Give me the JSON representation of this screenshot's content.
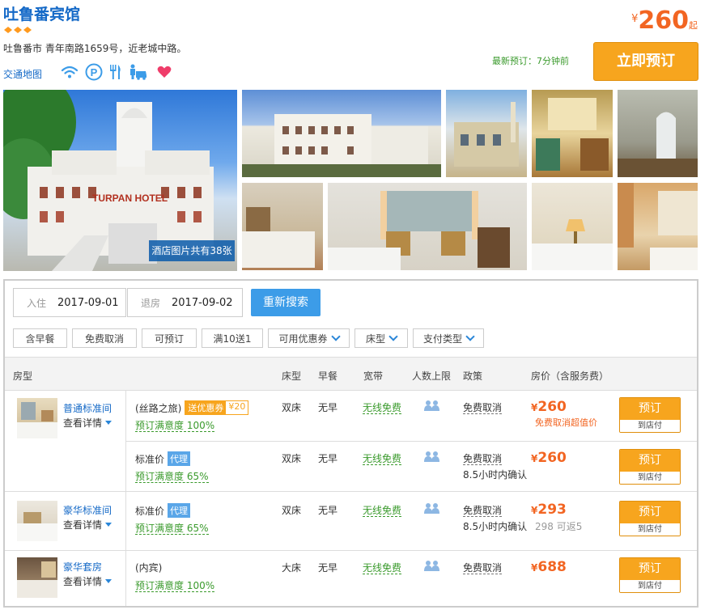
{
  "hotel": {
    "name": "吐鲁番宾馆",
    "rating_icon": "diamond-rating-3",
    "address": "吐鲁番市 青年南路1659号，近老城中路。",
    "map_link": "交通地图",
    "facility_icons": [
      "wifi-icon",
      "parking-icon",
      "restaurant-icon",
      "pickup-icon",
      "favorite-heart-icon"
    ],
    "price_currency": "¥",
    "price_from": "260",
    "price_suffix": "起",
    "latest_booking": "最新预订：7分钟前",
    "book_now": "立即预订",
    "photo_count": "酒店图片共有38张",
    "photo_watermark": "TURPAN HOTEL"
  },
  "search": {
    "checkin_label": "入住",
    "checkin_value": "2017-09-01",
    "checkout_label": "退房",
    "checkout_value": "2017-09-02",
    "search_button": "重新搜索"
  },
  "filters": [
    {
      "label": "含早餐",
      "dropdown": false
    },
    {
      "label": "免费取消",
      "dropdown": false
    },
    {
      "label": "可预订",
      "dropdown": false
    },
    {
      "label": "满10送1",
      "dropdown": false
    },
    {
      "label": "可用优惠券",
      "dropdown": true
    },
    {
      "label": "床型",
      "dropdown": true
    },
    {
      "label": "支付类型",
      "dropdown": true
    }
  ],
  "table": {
    "headers": [
      "房型",
      "床型",
      "早餐",
      "宽带",
      "人数上限",
      "政策",
      "房价（含服务费）"
    ],
    "detail_label": "查看详情",
    "rooms": [
      {
        "name": "普通标准间"
      },
      {
        "name": "豪华标准间"
      },
      {
        "name": "豪华套房"
      }
    ],
    "rate_rows": [
      {
        "plan": "(丝路之旅)",
        "coupon_tag": "送优惠券",
        "coupon_value": "¥20",
        "agent_tag": "",
        "satisfaction": "预订满意度 100%",
        "bed": "双床",
        "breakfast": "无早",
        "broadband": "无线免费",
        "policy": "免费取消",
        "policy_note": "",
        "currency": "¥",
        "price": "260",
        "price_note": "免费取消超值价",
        "cashback": "",
        "book": "预订",
        "pay": "到店付"
      },
      {
        "plan": "标准价",
        "coupon_tag": "",
        "coupon_value": "",
        "agent_tag": "代理",
        "satisfaction": "预订满意度 65%",
        "bed": "双床",
        "breakfast": "无早",
        "broadband": "无线免费",
        "policy": "免费取消",
        "policy_note": "8.5小时内确认",
        "currency": "¥",
        "price": "260",
        "price_note": "",
        "cashback": "",
        "book": "预订",
        "pay": "到店付"
      },
      {
        "plan": "标准价",
        "coupon_tag": "",
        "coupon_value": "",
        "agent_tag": "代理",
        "satisfaction": "预订满意度 65%",
        "bed": "双床",
        "breakfast": "无早",
        "broadband": "无线免费",
        "policy": "免费取消",
        "policy_note": "8.5小时内确认",
        "currency": "¥",
        "price": "293",
        "price_note": "",
        "cashback": "298 可返5",
        "book": "预订",
        "pay": "到店付"
      },
      {
        "plan": "(内宾)",
        "coupon_tag": "",
        "coupon_value": "",
        "agent_tag": "",
        "satisfaction": "预订满意度 100%",
        "bed": "大床",
        "breakfast": "无早",
        "broadband": "无线免费",
        "policy": "免费取消",
        "policy_note": "",
        "currency": "¥",
        "price": "688",
        "price_note": "",
        "cashback": "",
        "book": "预订",
        "pay": "到店付"
      }
    ]
  },
  "colors": {
    "brand_blue": "#1469c7",
    "accent_orange": "#f7a51e",
    "price_red": "#f26522",
    "green": "#3a9a2c"
  }
}
